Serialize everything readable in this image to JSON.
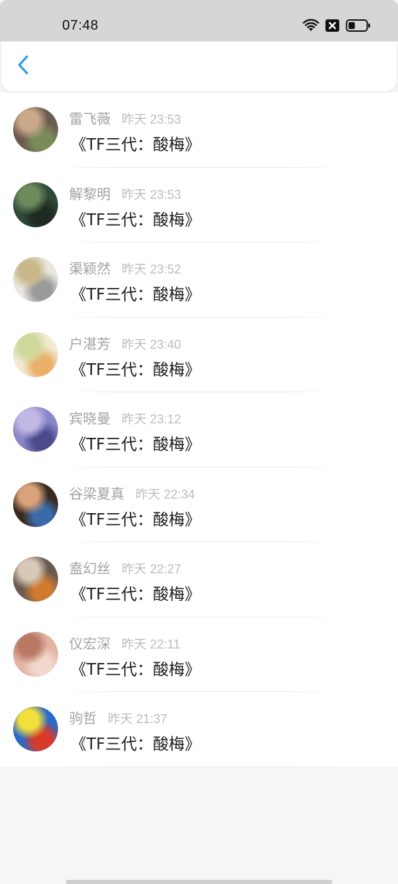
{
  "status_bar": {
    "time": "07:48",
    "icons": [
      "wifi-icon",
      "sim-off-icon",
      "battery-icon"
    ]
  },
  "header": {
    "back_icon": "chevron-left-icon",
    "accent_color": "#2d9ee8"
  },
  "comments": [
    {
      "name": "雷飞薇",
      "time": "昨天 23:53",
      "message": "《TF三代：酸梅》",
      "avatar_colors": [
        "#6b5a4e",
        "#c9a98a",
        "#7a8c5a"
      ]
    },
    {
      "name": "解黎明",
      "time": "昨天 23:53",
      "message": "《TF三代：酸梅》",
      "avatar_colors": [
        "#2f4a3a",
        "#6c8a5c",
        "#1e2a22"
      ]
    },
    {
      "name": "渠颖然",
      "time": "昨天 23:52",
      "message": "《TF三代：酸梅》",
      "avatar_colors": [
        "#e9e6df",
        "#c9b98a",
        "#9a9a9a"
      ]
    },
    {
      "name": "户湛芳",
      "time": "昨天 23:40",
      "message": "《TF三代：酸梅》",
      "avatar_colors": [
        "#f0ead2",
        "#cfd89a",
        "#e9b06a"
      ]
    },
    {
      "name": "宾晓曼",
      "time": "昨天 23:12",
      "message": "《TF三代：酸梅》",
      "avatar_colors": [
        "#8a86c8",
        "#c2b8e6",
        "#4b4a8a"
      ]
    },
    {
      "name": "谷梁夏真",
      "time": "昨天 22:34",
      "message": "《TF三代：酸梅》",
      "avatar_colors": [
        "#3a2a1e",
        "#d9a27a",
        "#3b6aa8"
      ]
    },
    {
      "name": "盍幻丝",
      "time": "昨天 22:27",
      "message": "《TF三代：酸梅》",
      "avatar_colors": [
        "#6a5a50",
        "#d8c8b8",
        "#d07a30"
      ]
    },
    {
      "name": "仪宏深",
      "time": "昨天 22:11",
      "message": "《TF三代：酸梅》",
      "avatar_colors": [
        "#e2b2a2",
        "#b87864",
        "#f2d8cc"
      ]
    },
    {
      "name": "驹哲",
      "time": "昨天 21:37",
      "message": "《TF三代：酸梅》",
      "avatar_colors": [
        "#2a6ac8",
        "#f2e03a",
        "#d83a2a"
      ]
    }
  ]
}
